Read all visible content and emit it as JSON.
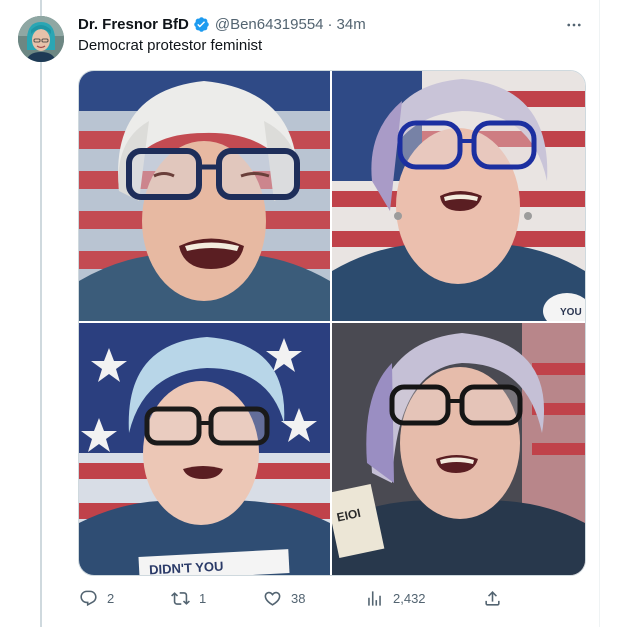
{
  "tweet": {
    "author_name": "Dr. Fresnor BfD",
    "handle": "@Ben64319554",
    "separator": "·",
    "time": "34m",
    "text": "Democrat protestor feminist",
    "verified_color": "#1d9bf0"
  },
  "media": {
    "images": [
      {
        "position": "top-left"
      },
      {
        "position": "top-right"
      },
      {
        "position": "bottom-left"
      },
      {
        "position": "bottom-right"
      }
    ],
    "sign_text_top_right": "YOU",
    "sign_text_bottom_left": "DIDN'T YOU",
    "sign_text_bottom_right": "EIOI"
  },
  "actions": {
    "replies": "2",
    "retweets": "1",
    "likes": "38",
    "views": "2,432"
  },
  "icons": [
    "reply-icon",
    "retweet-icon",
    "like-icon",
    "views-icon",
    "share-icon",
    "more-icon",
    "verified-badge-icon"
  ],
  "colors": {
    "text": "#0f1419",
    "secondary": "#536471",
    "accent": "#1d9bf0",
    "border": "#cfd9de"
  }
}
